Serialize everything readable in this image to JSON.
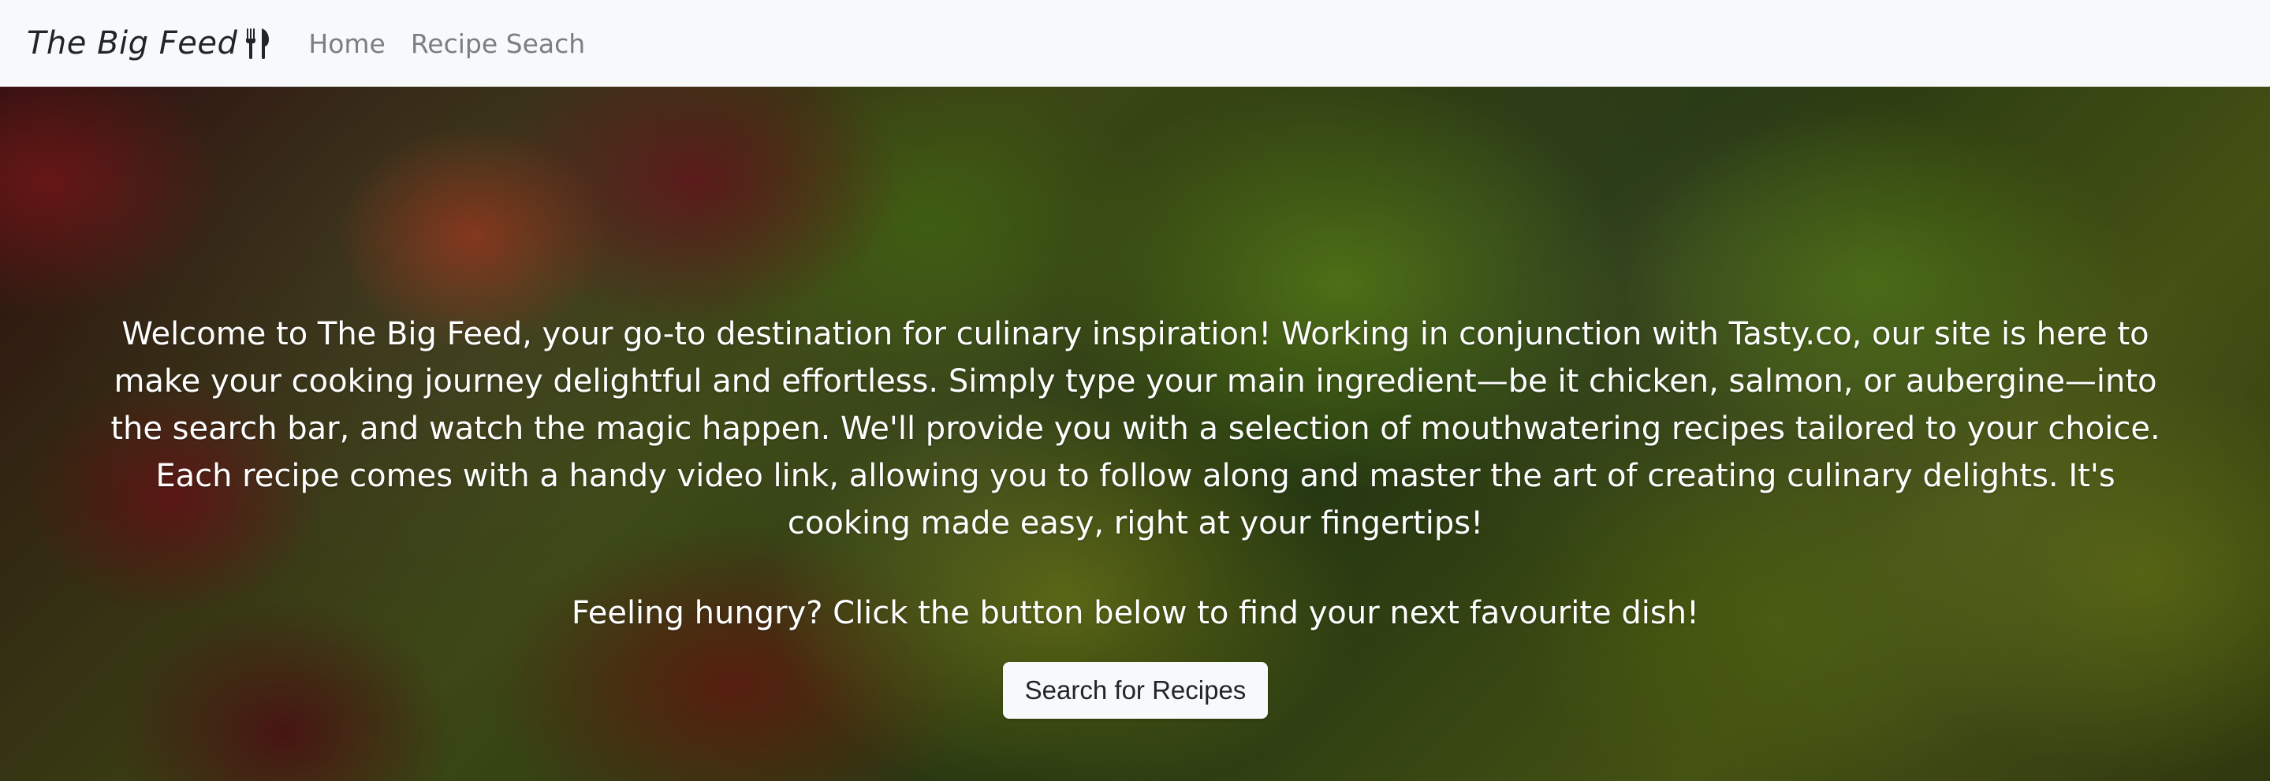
{
  "navbar": {
    "brand": "The Big Feed",
    "brand_icon": "utensils-icon",
    "links": [
      "Home",
      "Recipe Seach"
    ]
  },
  "hero": {
    "welcome_text": "Welcome to The Big Feed, your go-to destination for culinary inspiration! Working in conjunction with Tasty.co, our site is here to make your cooking journey delightful and effortless. Simply type your main ingredient—be it chicken, salmon, or aubergine—into the search bar, and watch the magic happen. We'll provide you with a selection of mouthwatering recipes tailored to your choice. Each recipe comes with a handy video link, allowing you to follow along and master the art of creating culinary delights. It's cooking made easy, right at your fingertips!",
    "cta_prompt": "Feeling hungry? Click the button below to find your next favourite dish!",
    "cta_button": "Search for Recipes"
  },
  "colors": {
    "navbar_bg": "#f8f9fa",
    "nav_link": "#7a7f84",
    "brand": "#212529",
    "hero_text": "#ffffff",
    "button_bg": "#f8f9fa"
  }
}
